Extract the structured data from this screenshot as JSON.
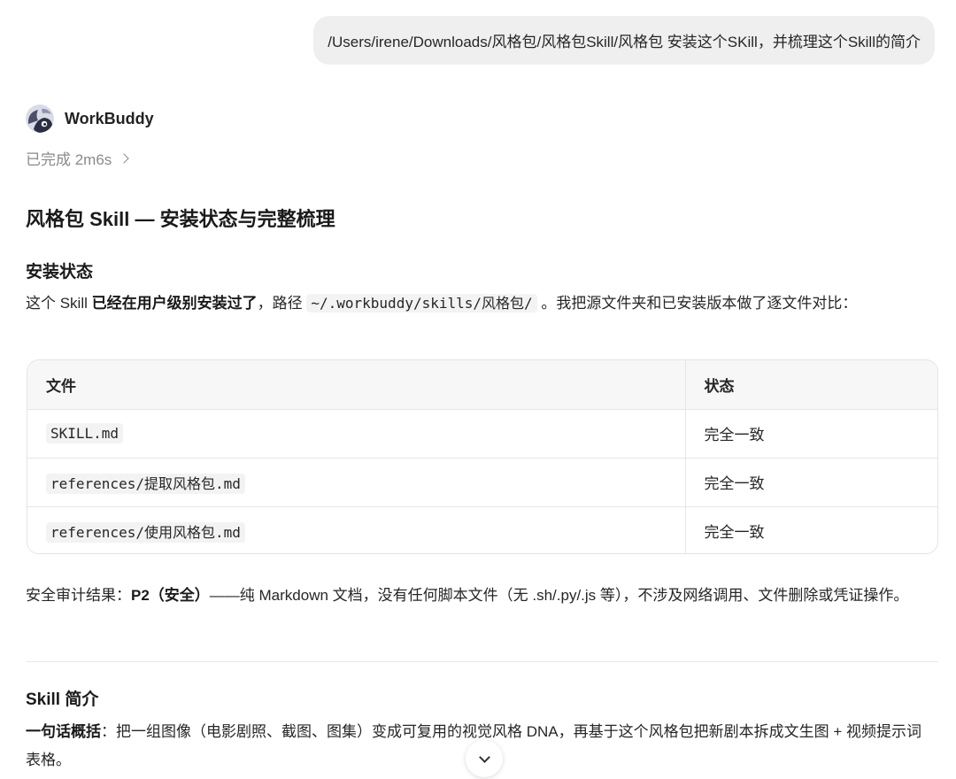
{
  "user_message": "/Users/irene/Downloads/风格包/风格包Skill/风格包 安装这个SKill，并梳理这个Skill的简介",
  "agent": {
    "name": "WorkBuddy",
    "status": "已完成 2m6s"
  },
  "title": "风格包 Skill — 安装状态与完整梳理",
  "install_section": {
    "heading": "安装状态",
    "text_1": "这个 Skill ",
    "text_bold": "已经在用户级别安装过了",
    "text_2": "，路径 ",
    "path": "~/.workbuddy/skills/风格包/",
    "text_3": " 。我把源文件夹和已安装版本做了逐文件对比："
  },
  "table": {
    "headers": [
      "文件",
      "状态"
    ],
    "rows": [
      {
        "file": "SKILL.md",
        "status": "完全一致"
      },
      {
        "file": "references/提取风格包.md",
        "status": "完全一致"
      },
      {
        "file": "references/使用风格包.md",
        "status": "完全一致"
      }
    ]
  },
  "audit": {
    "prefix": "安全审计结果：",
    "level": "P2（安全）",
    "text": "——纯 Markdown 文档，没有任何脚本文件（无 .sh/.py/.js 等），不涉及网络调用、文件删除或凭证操作。"
  },
  "intro_section": {
    "heading": "Skill 简介",
    "label": "一句话概括",
    "text": "：把一组图像（电影剧照、截图、图集）变成可复用的视觉风格 DNA，再基于这个风格包把新剧本拆成文生图 + 视频提示词表格。"
  },
  "icons": {
    "avatar": "workbuddy-avatar-icon",
    "status": "chevron-right-icon",
    "scroll": "chevron-down-icon"
  }
}
